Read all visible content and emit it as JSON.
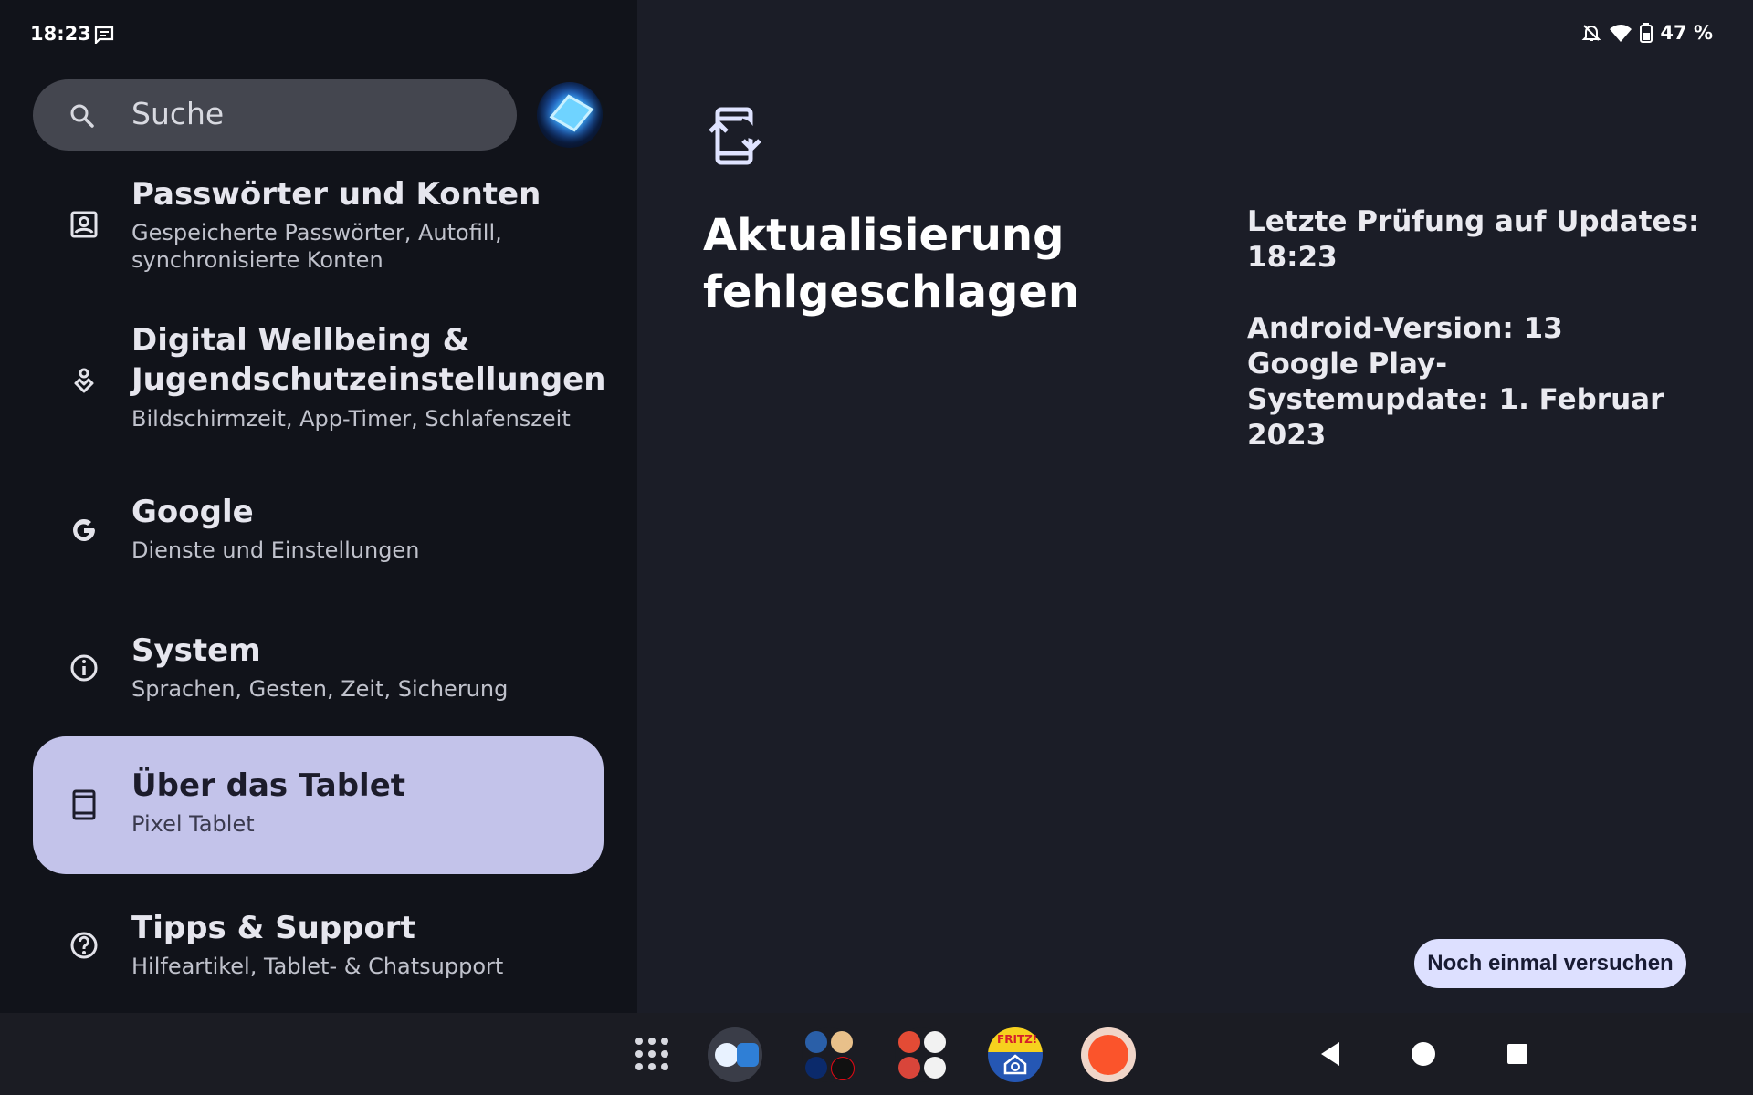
{
  "status_bar": {
    "time": "18:23",
    "battery": "47 %"
  },
  "search": {
    "placeholder": "Suche"
  },
  "settings_items": [
    {
      "title": "Passwörter und Konten",
      "subtitle": "Gespeicherte Passwörter, Autofill, synchronisierte Konten",
      "icon": "account-box-icon"
    },
    {
      "title": "Digital Wellbeing & Jugendschutzeinstellungen",
      "subtitle": "Bildschirmzeit, App-Timer, Schlafenszeit",
      "icon": "wellbeing-icon"
    },
    {
      "title": "Google",
      "subtitle": "Dienste und Einstellungen",
      "icon": "google-icon"
    },
    {
      "title": "System",
      "subtitle": "Sprachen, Gesten, Zeit, Sicherung",
      "icon": "info-icon"
    },
    {
      "title": "Über das Tablet",
      "subtitle": "Pixel Tablet",
      "icon": "tablet-icon",
      "selected": true
    },
    {
      "title": "Tipps & Support",
      "subtitle": "Hilfeartikel, Tablet- & Chatsupport",
      "icon": "help-icon"
    }
  ],
  "detail": {
    "headline": "Aktualisierung fehlgeschlagen",
    "last_check_label": "Letzte Prüfung auf Updates:",
    "last_check_time": "18:23",
    "android_version": "Android-Version: 13",
    "play_update": "Google Play-Systemupdate: 1. Februar 2023",
    "retry_button": "Noch einmal versuchen"
  },
  "taskbar": {
    "fritz_label": "FRITZ!"
  },
  "colors": {
    "selected_bg": "#c3c3ea",
    "button_bg": "#dde0ff",
    "pane_bg": "#1b1d27",
    "list_bg": "#11131a"
  }
}
